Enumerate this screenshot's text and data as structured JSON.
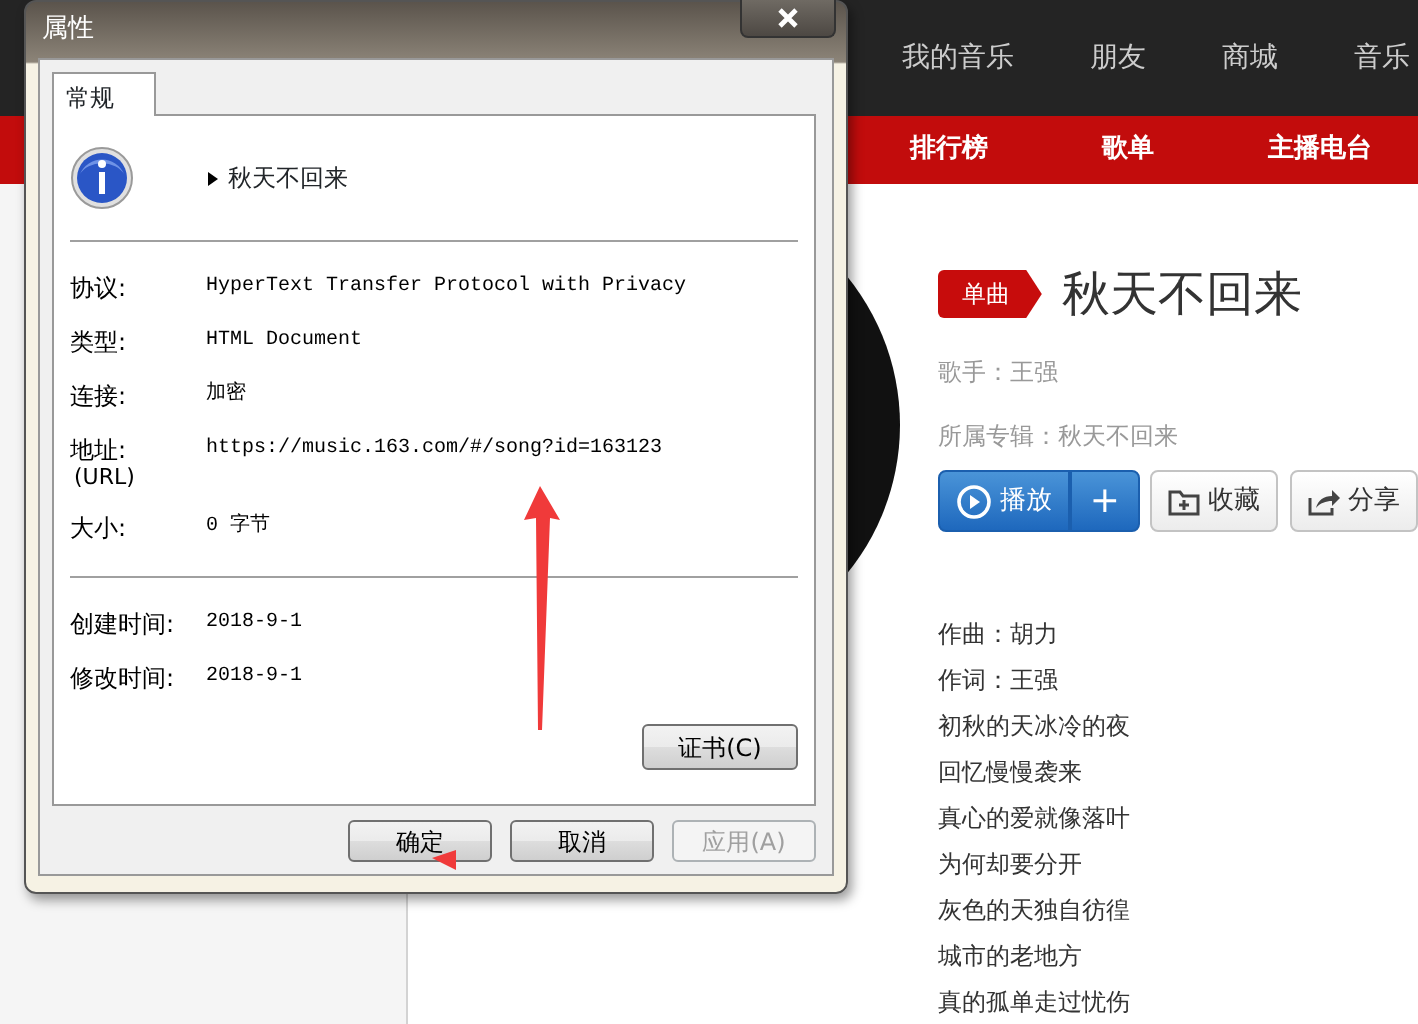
{
  "background_page": {
    "top_nav": [
      {
        "label": "我的音乐"
      },
      {
        "label": "朋友"
      },
      {
        "label": "商城"
      },
      {
        "label": "音乐"
      }
    ],
    "sub_nav": [
      {
        "label": "排行榜"
      },
      {
        "label": "歌单"
      },
      {
        "label": "主播电台"
      }
    ],
    "song": {
      "tag": "单曲",
      "title": "秋天不回来",
      "singer_label": "歌手：",
      "singer": "王强",
      "album_label": "所属专辑：",
      "album": "秋天不回来",
      "buttons": [
        {
          "kind": "play",
          "label": "播放"
        },
        {
          "kind": "add",
          "label": "+"
        },
        {
          "kind": "collect",
          "label": "收藏"
        },
        {
          "kind": "share",
          "label": "分享"
        }
      ]
    },
    "lyrics": [
      "作曲：胡力",
      "作词：王强",
      "初秋的天冰冷的夜",
      "回忆慢慢袭来",
      "真心的爱就像落叶",
      "为何却要分开",
      "灰色的天独自彷徨",
      "城市的老地方",
      "真的孤单走过忧伤"
    ]
  },
  "dialog": {
    "title": "属性",
    "tabs": [
      {
        "label": "常规",
        "selected": true
      }
    ],
    "name": "秋天不回来",
    "sections": [
      {
        "rows": [
          {
            "label": "协议:",
            "value": "HyperText Transfer Protocol with Privacy"
          },
          {
            "label": "类型:",
            "value": "HTML Document"
          },
          {
            "label": "连接:",
            "value": "加密"
          },
          {
            "label": "地址:",
            "sublabel": "(URL)",
            "value": "https://music.163.com/#/song?id=163123"
          },
          {
            "label": "大小:",
            "value": "0 字节"
          }
        ]
      },
      {
        "rows": [
          {
            "label": "创建时间:",
            "value": "2018-9-1"
          },
          {
            "label": "修改时间:",
            "value": "2018-9-1"
          }
        ]
      }
    ],
    "panel_buttons": [
      {
        "label": "证书(C)",
        "disabled": false
      }
    ],
    "footer_buttons": [
      {
        "label": "确定",
        "disabled": false
      },
      {
        "label": "取消",
        "disabled": false
      },
      {
        "label": "应用(A)",
        "disabled": true
      }
    ]
  }
}
